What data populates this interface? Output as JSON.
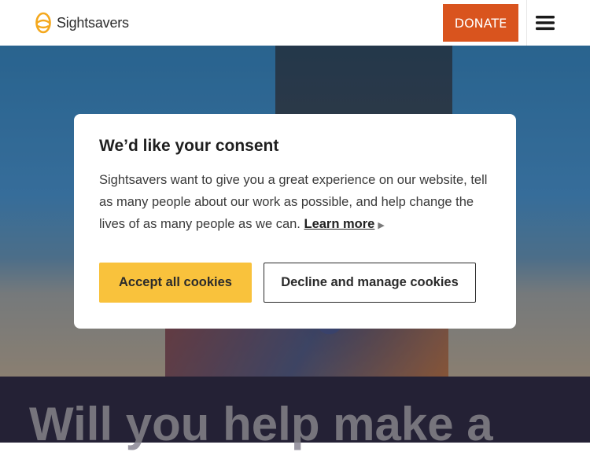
{
  "header": {
    "brand": "Sightsavers",
    "logo_icon": "sightsavers-logo-icon",
    "donate_label": "DONATE",
    "menu_icon": "hamburger-menu-icon"
  },
  "cookie_dialog": {
    "title": "We’d like your consent",
    "body": "Sightsavers want to give you a great experience on our website, tell as many people about our work as possible, and help change the lives of as many people as we can.",
    "learn_more_label": "Learn more",
    "learn_more_icon": "play-arrow-icon",
    "accept_label": "Accept all cookies",
    "decline_label": "Decline and manage cookies"
  },
  "page": {
    "headline": "Will you help make a"
  },
  "colors": {
    "donate": "#d9541e",
    "accept": "#f9c23c",
    "bottom_band": "#231e3c"
  }
}
